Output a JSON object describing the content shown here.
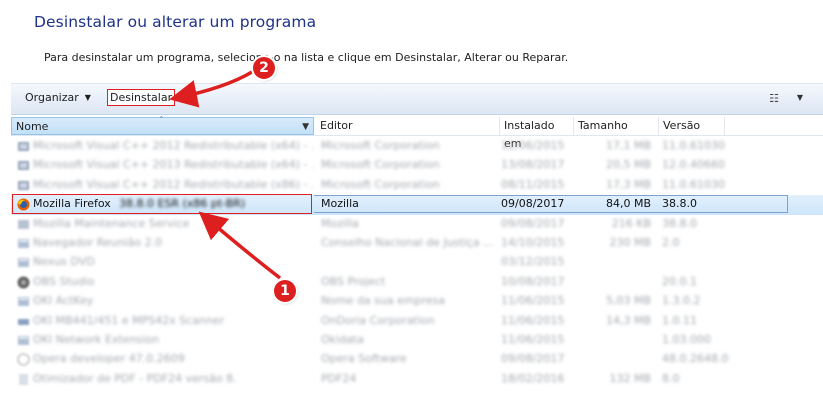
{
  "page": {
    "title": "Desinstalar ou alterar um programa",
    "subtitle": "Para desinstalar um programa, selecione-o na lista e clique em Desinstalar, Alterar ou Reparar."
  },
  "toolbar": {
    "organize_label": "Organizar",
    "uninstall_label": "Desinstalar",
    "view_icon": "view-options-icon"
  },
  "columns": {
    "name": "Nome",
    "publisher": "Editor",
    "installed": "Instalado em",
    "size": "Tamanho",
    "version": "Versão"
  },
  "rows": [
    {
      "name": "Microsoft Visual C++ 2012 Redistributable (x64) - ...",
      "publisher": "Microsoft Corporation",
      "installed": "12/06/2015",
      "size": "17,1 MB",
      "version": "11.0.61030",
      "icon": "installer-icon",
      "blurred": true
    },
    {
      "name": "Microsoft Visual C++ 2013 Redistributable (x64) - ...",
      "publisher": "Microsoft Corporation",
      "installed": "13/08/2017",
      "size": "20,5 MB",
      "version": "12.0.40660",
      "icon": "installer-icon",
      "blurred": true
    },
    {
      "name": "Microsoft Visual C++ 2012 Redistributable (x86) - ...",
      "publisher": "Microsoft Corporation",
      "installed": "08/11/2015",
      "size": "17,3 MB",
      "version": "11.0.61030",
      "icon": "installer-icon",
      "blurred": true
    },
    {
      "name": "Mozilla Firefox",
      "name_tail": "38.8.0 ESR (x86 pt-BR)",
      "publisher": "Mozilla",
      "installed": "09/08/2017",
      "size": "84,0 MB",
      "version": "38.8.0",
      "icon": "firefox-icon",
      "blurred": false,
      "selected": true
    },
    {
      "name": "Mozilla Maintenance Service",
      "publisher": "Mozilla",
      "installed": "09/08/2017",
      "size": "216 KB",
      "version": "38.8.0",
      "icon": "service-icon",
      "blurred": true
    },
    {
      "name": "Navegador Reunião 2.0",
      "publisher": "Conselho Nacional de Justiça ...",
      "installed": "14/10/2015",
      "size": "230 MB",
      "version": "2.0",
      "icon": "app-icon",
      "blurred": true
    },
    {
      "name": "Nexus DVD",
      "publisher": "",
      "installed": "03/12/2015",
      "size": "",
      "version": "",
      "icon": "app-icon",
      "blurred": true
    },
    {
      "name": "OBS Studio",
      "publisher": "OBS Project",
      "installed": "10/08/2017",
      "size": "",
      "version": "20.0.1",
      "icon": "obs-icon",
      "blurred": true
    },
    {
      "name": "OKI ActKey",
      "publisher": "Nome da sua empresa",
      "installed": "11/06/2015",
      "size": "5,03 MB",
      "version": "1.3.0.2",
      "icon": "app-icon",
      "blurred": true
    },
    {
      "name": "OKI MB441/451 e MPS42x Scanner",
      "publisher": "OnDoria Corporation",
      "installed": "11/06/2015",
      "size": "14,3 MB",
      "version": "1.0.11",
      "icon": "scanner-icon",
      "blurred": true
    },
    {
      "name": "OKI Network Extension",
      "publisher": "Okidata",
      "installed": "11/06/2015",
      "size": "",
      "version": "1.03.000",
      "icon": "app-icon",
      "blurred": true
    },
    {
      "name": "Opera developer 47.0.2609",
      "publisher": "Opera Software",
      "installed": "09/08/2017",
      "size": "",
      "version": "48.0.2648.0",
      "icon": "opera-icon",
      "blurred": true
    },
    {
      "name": "Otimizador de PDF - PDF24 versão 8.",
      "publisher": "PDF24",
      "installed": "18/02/2016",
      "size": "132 MB",
      "version": "8.0",
      "icon": "pdf-icon",
      "blurred": true
    }
  ],
  "annotations": {
    "callout_1": "1",
    "callout_2": "2"
  },
  "colors": {
    "title": "#1e3287",
    "callout": "#dd1f1f",
    "selection": "#cde5fb"
  }
}
